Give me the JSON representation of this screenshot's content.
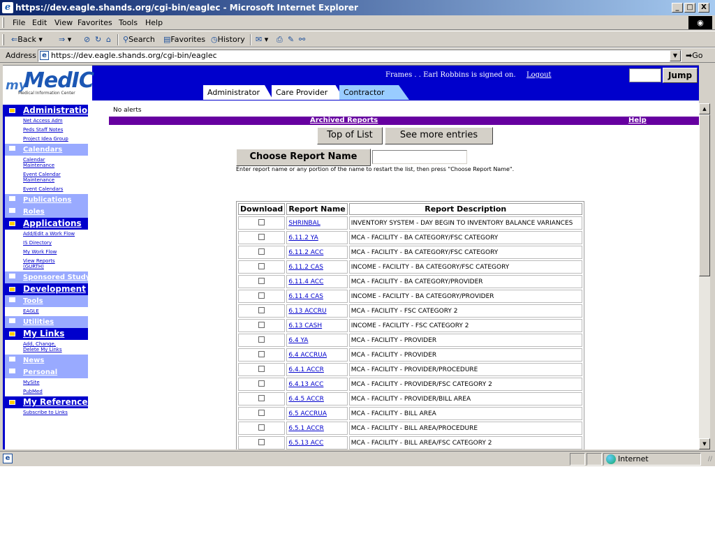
{
  "window": {
    "title": "https://dev.eagle.shands.org/cgi-bin/eaglec - Microsoft Internet Explorer",
    "minimize": "_",
    "maximize": "□",
    "close": "X"
  },
  "menu": {
    "items": [
      {
        "label": "File"
      },
      {
        "label": "Edit"
      },
      {
        "label": "View"
      },
      {
        "label": "Favorites"
      },
      {
        "label": "Tools"
      },
      {
        "label": "Help"
      }
    ]
  },
  "toolbar": {
    "back": "Back",
    "search": "Search",
    "favorites": "Favorites",
    "history": "History"
  },
  "address": {
    "label": "Address",
    "url": "https://dev.eagle.shands.org/cgi-bin/eaglec",
    "go": "Go"
  },
  "header": {
    "logo_my": "my",
    "logo_medic": "MedIC",
    "logo_sub": "Medical Information Center",
    "frames_text": "Frames . . Earl Robbins is signed on.",
    "logout": "Logout",
    "jump": "Jump",
    "tabs": [
      {
        "label": "Administrator"
      },
      {
        "label": "Care Provider"
      },
      {
        "label": "Contractor"
      }
    ]
  },
  "sidebar": {
    "administration": "Administration",
    "net_access_adm": "Net Access Adm",
    "peds_staff_notes": "Peds Staff Notes",
    "project_idea_group": "Project Idea Group",
    "calendars": "Calendars",
    "calendar_maintenance": "Calendar Maintenance",
    "event_calendar_maintenance": "Event Calendar Maintenance",
    "event_calendars": "Event Calendars",
    "publications": "Publications",
    "roles": "Roles",
    "applications": "Applications",
    "add_edit_work_flow": "Add/Edit a Work Flow",
    "is_directory": "IS Directory",
    "my_work_flow": "My Work Flow",
    "view_reports": "View Reports (GURTH)",
    "sponsored_study": "Sponsored Study",
    "development": "Development",
    "tools": "Tools",
    "eagle": "EAGLE",
    "utilities": "Utilities",
    "my_links": "My Links",
    "add_change_delete": "Add, Change, Delete My Links",
    "news": "News",
    "personal": "Personal",
    "mysite": "MySite",
    "pubmed": "PubMed",
    "my_references": "My References",
    "subscribe_to_links": "Subscribe to Links"
  },
  "main": {
    "alerts": "No alerts",
    "archived_reports": "Archived Reports",
    "help": "Help",
    "top_of_list": "Top of List",
    "see_more": "See more entries",
    "choose_report": "Choose Report Name",
    "hint": "Enter report name or any portion of the name to restart the list, then press \"Choose Report Name\".",
    "table_headers": {
      "download": "Download",
      "report_name": "Report Name",
      "report_description": "Report Description"
    },
    "rows": [
      {
        "name": "SHRINBAL",
        "desc": "INVENTORY SYSTEM - DAY BEGIN TO INVENTORY BALANCE VARIANCES"
      },
      {
        "name": "6.11.2 YA",
        "desc": "MCA - FACILITY - BA CATEGORY/FSC CATEGORY"
      },
      {
        "name": "6.11.2 ACC",
        "desc": "MCA - FACILITY - BA CATEGORY/FSC CATEGORY"
      },
      {
        "name": "6.11.2 CAS",
        "desc": "INCOME - FACILITY - BA CATEGORY/FSC CATEGORY"
      },
      {
        "name": "6.11.4 ACC",
        "desc": "MCA - FACILITY - BA CATEGORY/PROVIDER"
      },
      {
        "name": "6.11.4 CAS",
        "desc": "INCOME - FACILITY - BA CATEGORY/PROVIDER"
      },
      {
        "name": "6.13 ACCRU",
        "desc": "MCA - FACILITY - FSC CATEGORY 2"
      },
      {
        "name": "6.13 CASH",
        "desc": "INCOME - FACILITY - FSC CATEGORY 2"
      },
      {
        "name": "6.4 YA",
        "desc": "MCA - FACILITY - PROVIDER"
      },
      {
        "name": "6.4 ACCRUA",
        "desc": "MCA - FACILITY - PROVIDER"
      },
      {
        "name": "6.4.1 ACCR",
        "desc": "MCA - FACILITY - PROVIDER/PROCEDURE"
      },
      {
        "name": "6.4.13 ACC",
        "desc": "MCA - FACILITY - PROVIDER/FSC CATEGORY 2"
      },
      {
        "name": "6.4.5 ACCR",
        "desc": "MCA - FACILITY - PROVIDER/BILL AREA"
      },
      {
        "name": "6.5 ACCRUA",
        "desc": "MCA - FACILITY - BILL AREA"
      },
      {
        "name": "6.5.1 ACCR",
        "desc": "MCA - FACILITY - BILL AREA/PROCEDURE"
      },
      {
        "name": "6.5.13 ACC",
        "desc": "MCA - FACILITY - BILL AREA/FSC CATEGORY 2"
      }
    ]
  },
  "statusbar": {
    "zone": "Internet"
  },
  "icons": [
    "ie-page-icon",
    "back-arrow-icon",
    "forward-arrow-icon",
    "stop-icon",
    "refresh-icon",
    "home-icon",
    "search-icon",
    "favorites-icon",
    "history-icon",
    "mail-icon",
    "print-icon",
    "edit-icon",
    "discuss-icon",
    "folder-icon",
    "checkbox-icon",
    "globe-icon"
  ]
}
